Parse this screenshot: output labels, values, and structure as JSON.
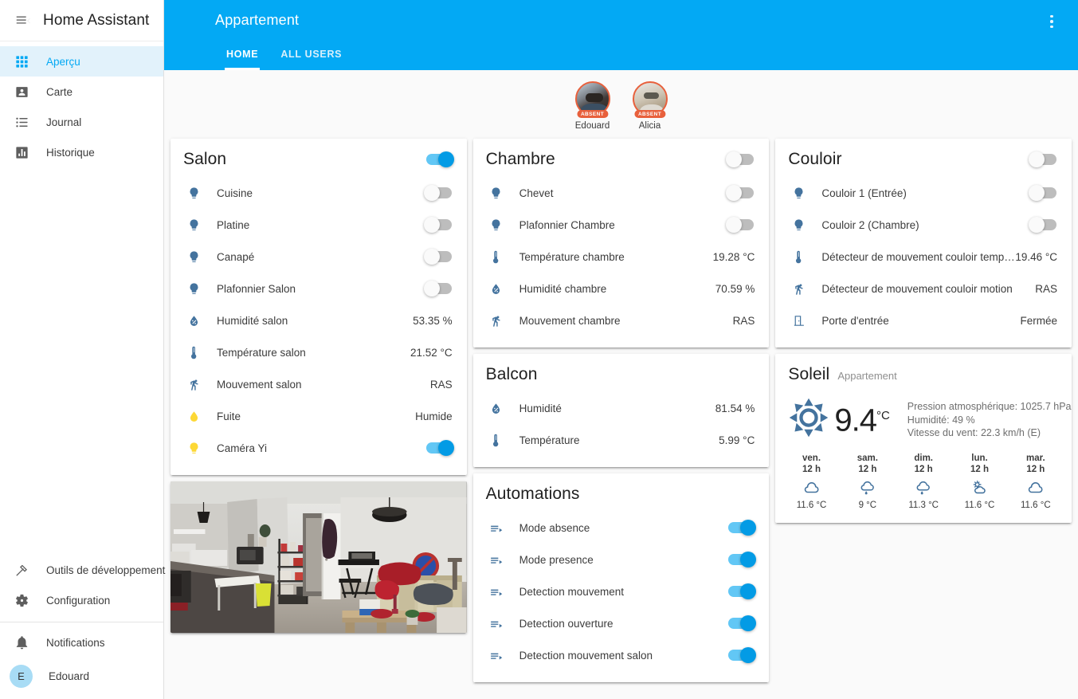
{
  "sidebar": {
    "title": "Home Assistant",
    "menu_icon": "menu-collapse-icon",
    "items": [
      {
        "label": "Aperçu",
        "icon": "view-dashboard-icon",
        "active": true
      },
      {
        "label": "Carte",
        "icon": "map-badge-icon",
        "active": false
      },
      {
        "label": "Journal",
        "icon": "format-list-icon",
        "active": false
      },
      {
        "label": "Historique",
        "icon": "chart-box-icon",
        "active": false
      }
    ],
    "bottom_items": [
      {
        "label": "Outils de développement",
        "icon": "hammer-icon"
      },
      {
        "label": "Configuration",
        "icon": "gear-icon"
      }
    ],
    "notifications": {
      "label": "Notifications",
      "icon": "bell-icon"
    },
    "user": {
      "label": "Edouard",
      "initial": "E"
    }
  },
  "topbar": {
    "title": "Appartement",
    "overflow_icon": "dots-vertical-icon",
    "tabs": [
      {
        "label": "HOME",
        "selected": true
      },
      {
        "label": "ALL USERS",
        "selected": false
      }
    ]
  },
  "people": [
    {
      "name": "Edouard",
      "badge": "ABSENT"
    },
    {
      "name": "Alicia",
      "badge": "ABSENT"
    }
  ],
  "cards": {
    "salon": {
      "title": "Salon",
      "header_toggle": "on",
      "rows": [
        {
          "name": "Cuisine",
          "icon": "lightbulb-icon",
          "control": "toggle",
          "state": "off"
        },
        {
          "name": "Platine",
          "icon": "lightbulb-icon",
          "control": "toggle",
          "state": "off"
        },
        {
          "name": "Canapé",
          "icon": "lightbulb-icon",
          "control": "toggle",
          "state": "off"
        },
        {
          "name": "Plafonnier Salon",
          "icon": "lightbulb-icon",
          "control": "toggle",
          "state": "off"
        },
        {
          "name": "Humidité salon",
          "icon": "water-percent-icon",
          "control": "value",
          "value": "53.35 %"
        },
        {
          "name": "Température salon",
          "icon": "thermometer-icon",
          "control": "value",
          "value": "21.52 °C"
        },
        {
          "name": "Mouvement salon",
          "icon": "walk-icon",
          "control": "value",
          "value": "RAS"
        },
        {
          "name": "Fuite",
          "icon": "water-drop-icon",
          "control": "value",
          "value": "Humide",
          "warn": true
        },
        {
          "name": "Caméra Yi",
          "icon": "lightbulb-icon",
          "control": "toggle",
          "state": "on",
          "warn": true
        }
      ]
    },
    "camera": {
      "name": "salon-camera-feed"
    },
    "chambre": {
      "title": "Chambre",
      "header_toggle": "off",
      "rows": [
        {
          "name": "Chevet",
          "icon": "lightbulb-icon",
          "control": "toggle",
          "state": "off"
        },
        {
          "name": "Plafonnier Chambre",
          "icon": "lightbulb-icon",
          "control": "toggle",
          "state": "off"
        },
        {
          "name": "Température chambre",
          "icon": "thermometer-icon",
          "control": "value",
          "value": "19.28 °C"
        },
        {
          "name": "Humidité chambre",
          "icon": "water-percent-icon",
          "control": "value",
          "value": "70.59 %"
        },
        {
          "name": "Mouvement chambre",
          "icon": "walk-icon",
          "control": "value",
          "value": "RAS"
        }
      ]
    },
    "balcon": {
      "title": "Balcon",
      "rows": [
        {
          "name": "Humidité",
          "icon": "water-percent-icon",
          "control": "value",
          "value": "81.54 %"
        },
        {
          "name": "Température",
          "icon": "thermometer-icon",
          "control": "value",
          "value": "5.99 °C"
        }
      ]
    },
    "automations": {
      "title": "Automations",
      "rows": [
        {
          "name": "Mode absence",
          "icon": "playlist-play-icon",
          "control": "toggle",
          "state": "on"
        },
        {
          "name": "Mode presence",
          "icon": "playlist-play-icon",
          "control": "toggle",
          "state": "on"
        },
        {
          "name": "Detection mouvement",
          "icon": "playlist-play-icon",
          "control": "toggle",
          "state": "on"
        },
        {
          "name": "Detection ouverture",
          "icon": "playlist-play-icon",
          "control": "toggle",
          "state": "on"
        },
        {
          "name": "Detection mouvement salon",
          "icon": "playlist-play-icon",
          "control": "toggle",
          "state": "on"
        }
      ]
    },
    "couloir": {
      "title": "Couloir",
      "header_toggle": "off",
      "rows": [
        {
          "name": "Couloir 1 (Entrée)",
          "icon": "lightbulb-icon",
          "control": "toggle",
          "state": "off"
        },
        {
          "name": "Couloir 2 (Chambre)",
          "icon": "lightbulb-icon",
          "control": "toggle",
          "state": "off"
        },
        {
          "name": "Détecteur de mouvement couloir temperature",
          "icon": "thermometer-icon",
          "control": "value",
          "value": "19.46 °C"
        },
        {
          "name": "Détecteur de mouvement couloir motion",
          "icon": "walk-icon",
          "control": "value",
          "value": "RAS"
        },
        {
          "name": "Porte d'entrée",
          "icon": "door-icon",
          "control": "value",
          "value": "Fermée"
        }
      ]
    },
    "soleil": {
      "title": "Soleil",
      "subtitle": "Appartement",
      "condition_icon": "sunny-icon",
      "temperature": "9.4",
      "unit": "°C",
      "details": [
        "Pression atmosphérique: 1025.7 hPa",
        "Humidité: 49 %",
        "Vitesse du vent: 22.3 km/h (E)"
      ],
      "forecast": [
        {
          "day": "ven.",
          "hour": "12 h",
          "icon": "cloudy-icon",
          "temp": "11.6 °C"
        },
        {
          "day": "sam.",
          "hour": "12 h",
          "icon": "rainy-icon",
          "temp": "9 °C"
        },
        {
          "day": "dim.",
          "hour": "12 h",
          "icon": "rainy-icon",
          "temp": "11.3 °C"
        },
        {
          "day": "lun.",
          "hour": "12 h",
          "icon": "partly-cloudy-icon",
          "temp": "11.6 °C"
        },
        {
          "day": "mar.",
          "hour": "12 h",
          "icon": "cloudy-icon",
          "temp": "11.6 °C"
        }
      ]
    }
  },
  "colors": {
    "accent": "#03a9f4",
    "icon_blue": "#44739e",
    "icon_warn": "#fdd835",
    "badge": "#e8603c"
  }
}
